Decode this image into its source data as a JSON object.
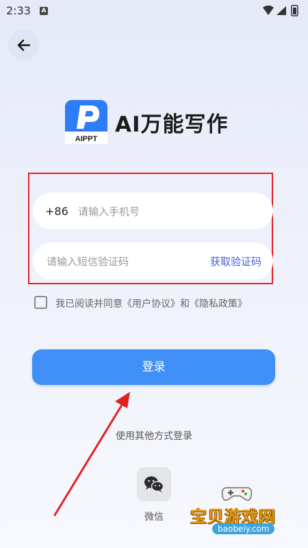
{
  "status_bar": {
    "time": "2:33",
    "app_icon_letter": "A"
  },
  "header": {
    "back_icon": "arrow-left-icon"
  },
  "logo": {
    "badge_text": "AIPPT",
    "title": "AI万能写作",
    "brand_color": "#2f7df6"
  },
  "form": {
    "phone": {
      "country_code": "+86",
      "placeholder": "请输入手机号",
      "value": ""
    },
    "code": {
      "placeholder": "请输入短信验证码",
      "value": "",
      "get_code_label": "获取验证码"
    },
    "agreement": {
      "prefix": "我已阅读并同意",
      "user_agreement": "《用户协议》",
      "conjunction": "和",
      "privacy_policy": "《隐私政策》",
      "checked": false
    },
    "login_label": "登录"
  },
  "other_login": {
    "label": "使用其他方式登录",
    "wechat_label": "微信"
  },
  "watermark": {
    "title": "宝贝游戏网",
    "url": "baobeiy.com"
  },
  "colors": {
    "primary": "#3f8ff7",
    "link": "#4a5fd8",
    "highlight_box": "#e02020"
  }
}
